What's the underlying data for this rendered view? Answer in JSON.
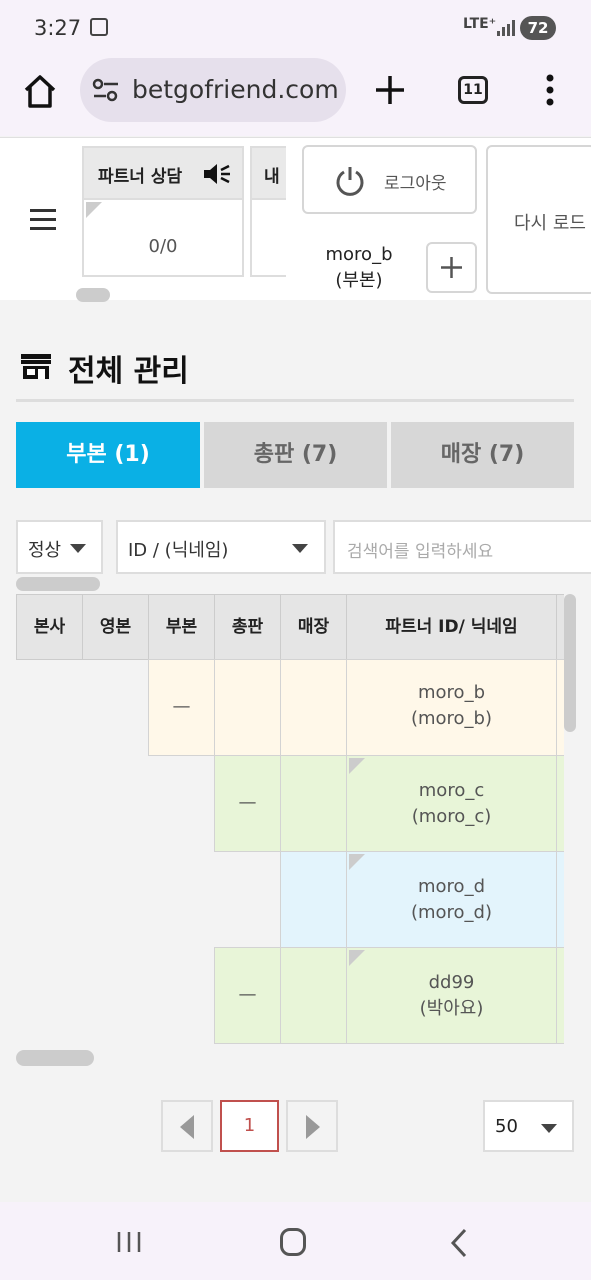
{
  "status": {
    "time": "3:27",
    "network": "LTE⁺",
    "battery": "72"
  },
  "browser": {
    "url": "betgofriend.com",
    "tab_count": "11"
  },
  "header": {
    "counter_title": "파트너 상담",
    "counter_value": "0/0",
    "counter2_title": "내",
    "logout_label": "로그아웃",
    "username_line1": "moro_b",
    "username_line2": "(부본)",
    "reload_label": "다시 로드"
  },
  "page": {
    "title": "전체 관리"
  },
  "tabs": [
    {
      "label": "부본 (1)",
      "active": true
    },
    {
      "label": "총판 (7)",
      "active": false
    },
    {
      "label": "매장 (7)",
      "active": false
    }
  ],
  "filters": {
    "status_value": "정상",
    "type_value": "ID / (닉네임)",
    "search_placeholder": "검색어를 입력하세요"
  },
  "table": {
    "columns": [
      "본사",
      "영본",
      "부본",
      "총판",
      "매장",
      "파트너 ID/ 닉네임"
    ],
    "rows": [
      {
        "id": "moro_b",
        "nick": "(moro_b)",
        "dash": "—"
      },
      {
        "id": "moro_c",
        "nick": "(moro_c)",
        "dash": "—"
      },
      {
        "id": "moro_d",
        "nick": "(moro_d)",
        "dash": ""
      },
      {
        "id": "dd99",
        "nick": "(박아요)",
        "dash": "—"
      }
    ]
  },
  "pagination": {
    "current_page": "1",
    "page_size": "50"
  },
  "colors": {
    "accent": "#0ab0e5",
    "row_yellow": "#fff8e9",
    "row_green": "#e8f5d8",
    "row_blue": "#e3f4fc",
    "page_border": "#c0504d"
  }
}
